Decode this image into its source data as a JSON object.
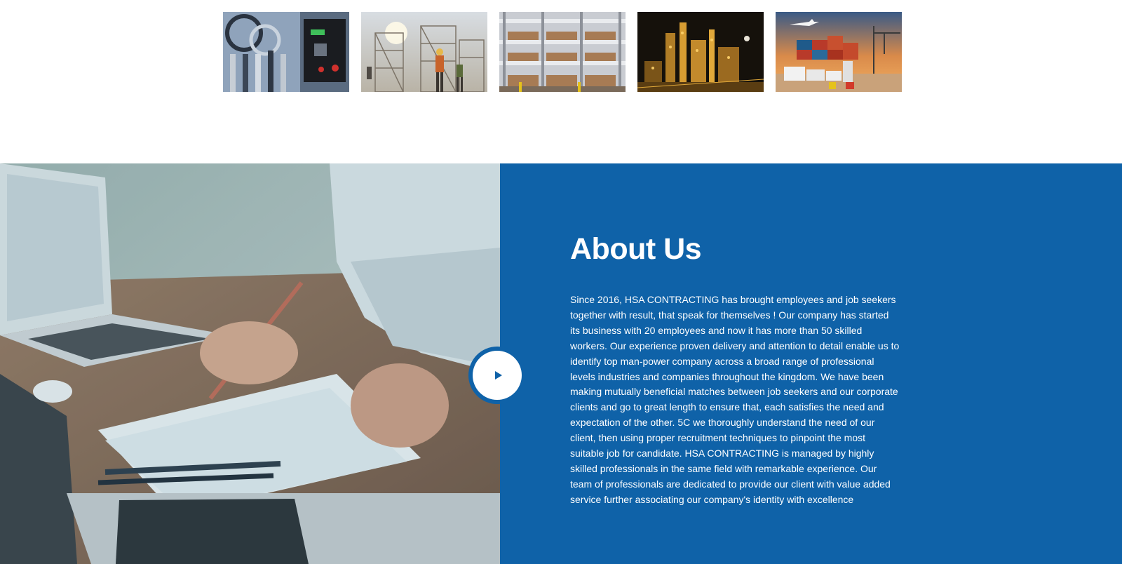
{
  "gallery": {
    "items": [
      {
        "name": "industrial-control-panel-image"
      },
      {
        "name": "construction-workers-scaffold-image"
      },
      {
        "name": "warehouse-pallet-racks-image"
      },
      {
        "name": "refinery-night-image"
      },
      {
        "name": "logistics-containers-trucks-image"
      }
    ]
  },
  "about": {
    "title": "About Us",
    "body": "Since 2016, HSA CONTRACTING has brought employees and job seekers together with result, that speak for themselves ! Our company has started its business with 20 employees and now it has more than 50 skilled workers. Our experience proven delivery and attention to detail enable us to identify top man-power company across a broad range of professional levels industries and companies throughout the kingdom. We have been making mutually beneficial matches between job seekers and our corporate clients and go to great length to ensure that, each satisfies the need and expectation of the other. 5C we thoroughly understand the need of our client, then using proper recruitment techniques to pinpoint the most suitable job for candidate. HSA CONTRACTING is managed by highly skilled professionals in the same field with remarkable experience. Our team of professionals are dedicated to provide our client with value added service further associating our company's identity with excellence",
    "play_icon": "play-icon",
    "accent_color": "#0f62a8"
  }
}
